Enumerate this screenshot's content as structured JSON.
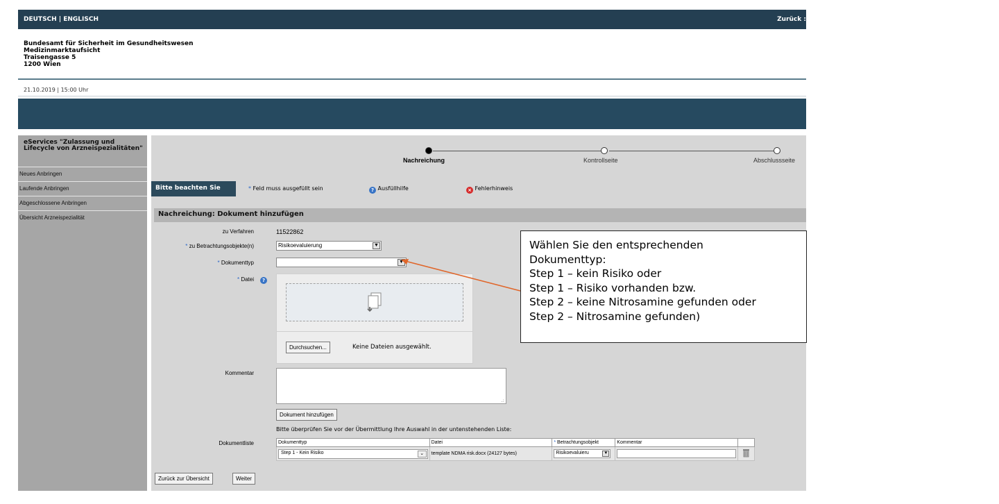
{
  "header": {
    "languages": "DEUTSCH | ENGLISCH",
    "back_link": "Zurück :"
  },
  "org": {
    "line1": "Bundesamt für Sicherheit im Gesundheitswesen",
    "line2": "Medizinmarktaufsicht",
    "line3": "Traisengasse 5",
    "line4": "1200 Wien"
  },
  "datetime": "21.10.2019 | 15:00 Uhr",
  "sidebar": {
    "title": "eServices \"Zulassung und Lifecycle von Arzneispezialitäten\"",
    "items": [
      {
        "label": "Neues Anbringen"
      },
      {
        "label": "Laufende Anbringen"
      },
      {
        "label": "Abgeschlossene Anbringen"
      },
      {
        "label": "Übersicht Arzneispezialität"
      }
    ]
  },
  "steps": {
    "step1": "Nachreichung",
    "step2": "Kontrollseite",
    "step3": "Abschlussseite",
    "active_index": 0
  },
  "notice": {
    "tag": "Bitte beachten Sie",
    "required": "Feld muss ausgefüllt sein",
    "help": "Ausfüllhilfe",
    "error": "Fehlerhinweis"
  },
  "section_title": "Nachreichung: Dokument hinzufügen",
  "form": {
    "verfahren_label": "zu Verfahren",
    "verfahren_value": "11522862",
    "objekt_label": "zu Betrachtungsobjekte(n)",
    "objekt_value": "Risikoevaluierung",
    "typ_label": "Dokumenttyp",
    "typ_value": "",
    "datei_label": "Datei",
    "browse_button": "Durchsuchen...",
    "no_file": "Keine Dateien ausgewählt.",
    "kommentar_label": "Kommentar",
    "add_button": "Dokument hinzufügen",
    "review_text": "Bitte überprüfen Sie vor der Übermittlung Ihre Auswahl in der untenstehenden Liste:",
    "doclist_label": "Dokumentliste"
  },
  "doctable": {
    "headers": [
      "Dokumenttyp",
      "Datei",
      "Betrachtungsobjekt",
      "Kommentar"
    ],
    "rows": [
      {
        "typ": "Step 1 - Kein Risiko",
        "datei": "template NDMA risk.docx (24127 bytes)",
        "objekt": "Risikoevaluieru",
        "kommentar": ""
      }
    ]
  },
  "footer": {
    "back_button": "Zurück zur Übersicht",
    "next_button": "Weiter"
  },
  "callout": {
    "line1": "Wählen Sie den entsprechenden",
    "line2": "Dokumenttyp:",
    "line3": "Step 1 – kein Risiko oder",
    "line4": "Step 1 – Risiko vorhanden bzw.",
    "line5": "Step 2 – keine Nitrosamine gefunden oder",
    "line6": "Step 2 – Nitrosamine gefunden)"
  },
  "colors": {
    "topbar": "#243f52",
    "banner": "#264a60",
    "sidebar": "#a6a6a6",
    "panel": "#d6d6d6",
    "arrow": "#e0662a"
  }
}
